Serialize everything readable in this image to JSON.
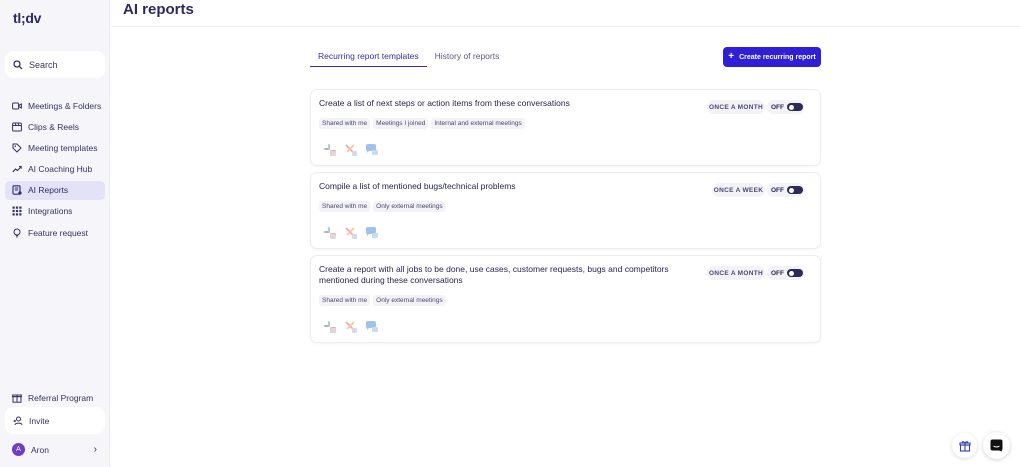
{
  "app": {
    "logo": "tl;dv"
  },
  "sidebar": {
    "search_label": "Search",
    "items": [
      {
        "label": "Meetings & Folders",
        "icon": "video-icon"
      },
      {
        "label": "Clips & Reels",
        "icon": "clips-icon"
      },
      {
        "label": "Meeting templates",
        "icon": "tag-icon"
      },
      {
        "label": "AI Coaching Hub",
        "icon": "trend-icon"
      },
      {
        "label": "AI Reports",
        "icon": "report-icon",
        "active": true
      },
      {
        "label": "Integrations",
        "icon": "grid-icon"
      },
      {
        "label": "Feature request",
        "icon": "bulb-icon"
      }
    ],
    "referral": "Referral Program",
    "invite": "Invite",
    "user": {
      "initial": "A",
      "name": "Aron"
    }
  },
  "header": {
    "title": "AI reports"
  },
  "tabs": [
    {
      "label": "Recurring report templates",
      "active": true
    },
    {
      "label": "History of reports",
      "active": false
    }
  ],
  "create_button": {
    "label": "Create recurring report"
  },
  "reports": [
    {
      "title": "Create a list of next steps or action items from these conversations",
      "frequency": "ONCE A MONTH",
      "toggle": "OFF",
      "tags": [
        "Shared with me",
        "Meetings I joined",
        "Internal and external meetings"
      ]
    },
    {
      "title": "Compile a list of mentioned bugs/technical problems",
      "frequency": "ONCE A WEEK",
      "toggle": "OFF",
      "tags": [
        "Shared with me",
        "Only external meetings"
      ]
    },
    {
      "title": "Create a report with all jobs to be done, use cases, customer requests, bugs and competitors mentioned during these conversations",
      "frequency": "ONCE A MONTH",
      "toggle": "OFF",
      "tags": [
        "Shared with me",
        "Only external meetings"
      ]
    }
  ],
  "colors": {
    "accent": "#2f1fd6",
    "active_nav": "#e4e2f7",
    "sidebar_bg": "#f5f5fa"
  }
}
